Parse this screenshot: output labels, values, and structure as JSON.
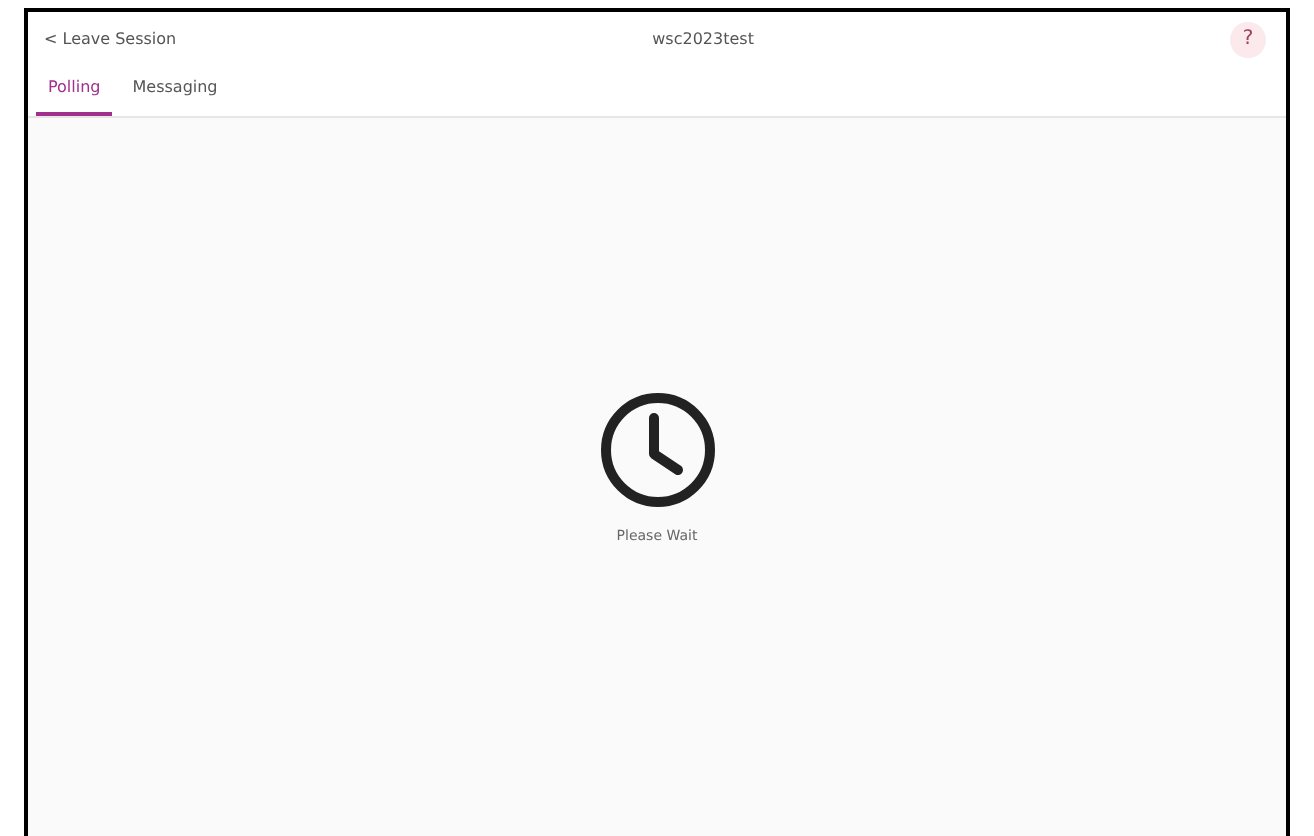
{
  "header": {
    "back_label": "Leave Session",
    "back_glyph": "<",
    "title": "wsc2023test",
    "help_label": "?"
  },
  "tabs": [
    {
      "label": "Polling",
      "selected": true
    },
    {
      "label": "Messaging",
      "selected": false
    }
  ],
  "status": {
    "message": "Please Wait"
  }
}
